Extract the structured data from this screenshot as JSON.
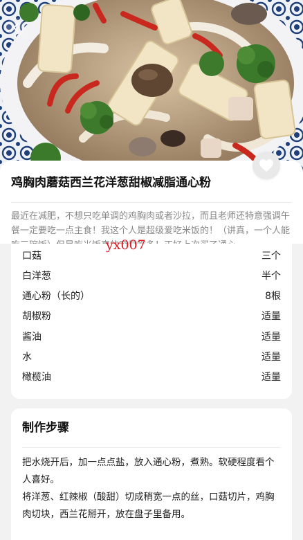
{
  "recipe": {
    "title": "鸡胸肉蘑菇西兰花洋葱甜椒减脂通心粉",
    "intro": "最近在减肥，不想只吃单调的鸡胸肉或者沙拉，而且老师还特意强调午餐一定要吃一点主食！我这个人是超级爱吃米饭的！（讲真，一个人能吃三碗饭）但是吃米饭真的容易吃多！正好上次买了通心..."
  },
  "watermark": "yx007",
  "ingredients": [
    {
      "name": "口菇",
      "amount": "三个"
    },
    {
      "name": "白洋葱",
      "amount": "半个"
    },
    {
      "name": "通心粉（长的）",
      "amount": "8根"
    },
    {
      "name": "胡椒粉",
      "amount": "适量"
    },
    {
      "name": "酱油",
      "amount": "适量"
    },
    {
      "name": "水",
      "amount": "适量"
    },
    {
      "name": "橄榄油",
      "amount": "适量"
    }
  ],
  "steps": {
    "heading": "制作步骤",
    "items": [
      "把水烧开后，加一点点盐，放入通心粉，煮熟。软硬程度看个人喜好。",
      "将洋葱、红辣椒（酸甜）切成稍宽一点的丝，口菇切片，鸡胸肉切块，西兰花掰开，放在盘子里备用。"
    ]
  },
  "icons": {
    "back": "chevron-left-icon",
    "favorite": "heart-icon"
  },
  "colors": {
    "watermark": "#e0151e",
    "card": "#ffffff",
    "page_bg": "#f2f2f2",
    "intro_text": "#888888"
  }
}
